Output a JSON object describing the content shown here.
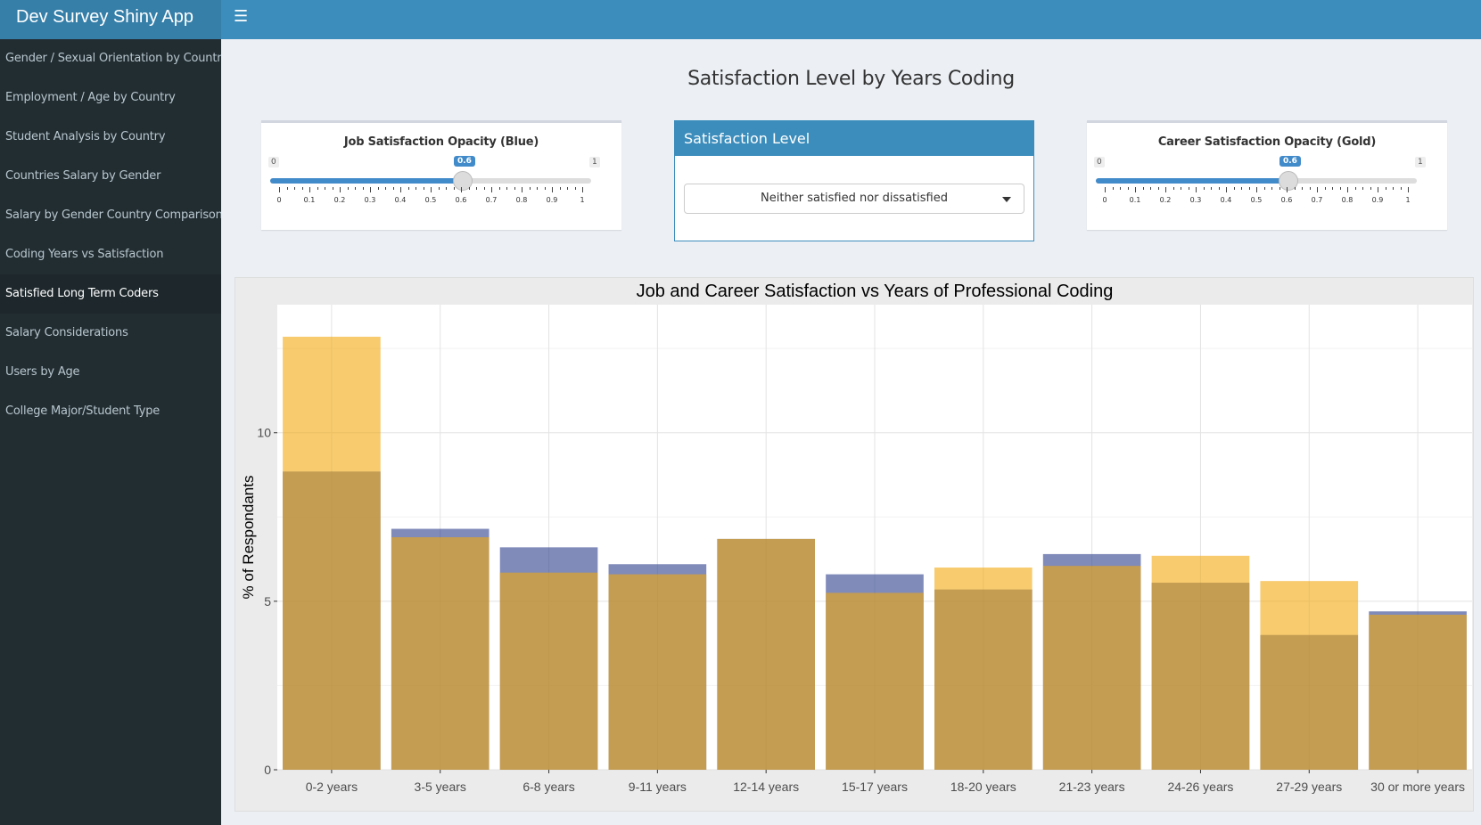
{
  "app": {
    "title": "Dev Survey Shiny App"
  },
  "sidebar": {
    "items": [
      {
        "label": "Gender / Sexual Orientation by Country",
        "active": false
      },
      {
        "label": "Employment / Age by Country",
        "active": false
      },
      {
        "label": "Student Analysis by Country",
        "active": false
      },
      {
        "label": "Countries Salary by Gender",
        "active": false
      },
      {
        "label": "Salary by Gender Country Comparison",
        "active": false
      },
      {
        "label": "Coding Years vs Satisfaction",
        "active": false
      },
      {
        "label": "Satisfied Long Term Coders",
        "active": true
      },
      {
        "label": "Salary Considerations",
        "active": false
      },
      {
        "label": "Users by Age",
        "active": false
      },
      {
        "label": "College Major/Student Type",
        "active": false
      }
    ]
  },
  "page": {
    "title": "Satisfaction Level by Years Coding"
  },
  "job_slider": {
    "label": "Job Satisfaction Opacity (Blue)",
    "min": 0,
    "max": 1,
    "value": 0.6,
    "min_label": "0",
    "max_label": "1",
    "value_label": "0.6",
    "ticks": [
      "0",
      "0.1",
      "0.2",
      "0.3",
      "0.4",
      "0.5",
      "0.6",
      "0.7",
      "0.8",
      "0.9",
      "1"
    ]
  },
  "career_slider": {
    "label": "Career Satisfaction Opacity (Gold)",
    "min": 0,
    "max": 1,
    "value": 0.6,
    "min_label": "0",
    "max_label": "1",
    "value_label": "0.6",
    "ticks": [
      "0",
      "0.1",
      "0.2",
      "0.3",
      "0.4",
      "0.5",
      "0.6",
      "0.7",
      "0.8",
      "0.9",
      "1"
    ]
  },
  "satisfaction_select": {
    "header": "Satisfaction Level",
    "selected": "Neither satisfied nor dissatisfied"
  },
  "colors": {
    "header": "#3c8dbc",
    "logo": "#367fa9",
    "sidebar": "#222d32",
    "job_bar": "#2b3e8c",
    "career_bar": "#f2a90d",
    "slider": "#428bca"
  },
  "chart_data": {
    "type": "bar",
    "title": "Job and Career Satisfaction vs Years of Professional Coding",
    "xlabel": "",
    "ylabel": "% of Respondants",
    "ylim": [
      0,
      13.8
    ],
    "yticks": [
      0,
      5,
      10
    ],
    "grid": true,
    "categories": [
      "0-2 years",
      "3-5 years",
      "6-8 years",
      "9-11 years",
      "12-14 years",
      "15-17 years",
      "18-20 years",
      "21-23 years",
      "24-26 years",
      "27-29 years",
      "30 or more years"
    ],
    "series": [
      {
        "color": "#2b3e8c",
        "opacity": 0.6,
        "values": [
          8.85,
          7.15,
          6.6,
          6.1,
          6.85,
          5.8,
          5.35,
          6.4,
          5.55,
          4.0,
          4.7
        ]
      },
      {
        "color": "#f2a90d",
        "opacity": 0.6,
        "values": [
          12.85,
          6.9,
          5.85,
          5.8,
          6.85,
          5.25,
          6.0,
          6.05,
          6.35,
          5.6,
          4.6
        ]
      }
    ]
  }
}
